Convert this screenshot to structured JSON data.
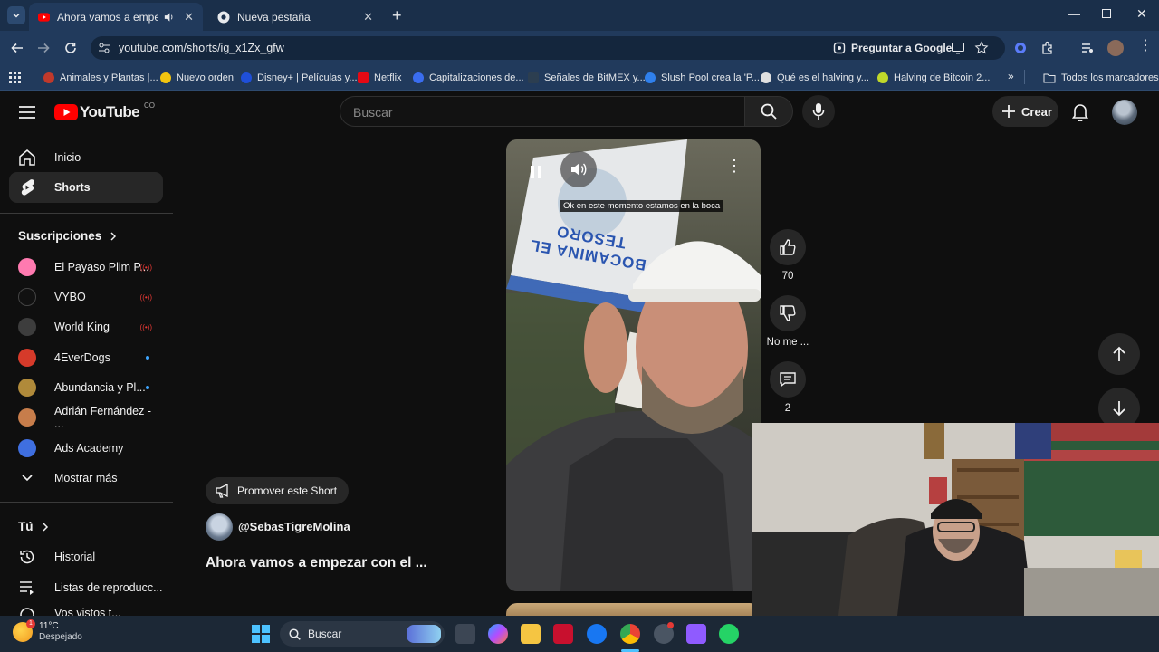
{
  "browser": {
    "tabs": [
      {
        "title": "Ahora vamos a empezar con el",
        "active": true
      },
      {
        "title": "Nueva pestaña",
        "active": false
      }
    ],
    "url": "youtube.com/shorts/ig_x1Zx_gfw",
    "ask_google": "Preguntar a Google",
    "bookmarks": [
      {
        "label": "Animales y Plantas |...",
        "color": "#c0392b"
      },
      {
        "label": "Nuevo orden",
        "color": "#f1c40f"
      },
      {
        "label": "Disney+ | Películas y...",
        "color": "#1f4fd8"
      },
      {
        "label": "Netflix",
        "color": "#e50914"
      },
      {
        "label": "Capitalizaciones de...",
        "color": "#3a6df0"
      },
      {
        "label": "Señales de BitMEX y...",
        "color": "#2c3e50"
      },
      {
        "label": "Slush Pool crea la 'P...",
        "color": "#2f80ed"
      },
      {
        "label": "Qué es el halving y...",
        "color": "#e0e0e0"
      },
      {
        "label": "Halving de Bitcoin 2...",
        "color": "#c0d82a"
      }
    ],
    "all_bookmarks": "Todos los marcadores"
  },
  "youtube": {
    "logo_text": "YouTube",
    "country": "CO",
    "search_placeholder": "Buscar",
    "create_label": "Crear",
    "sidebar": {
      "home": "Inicio",
      "shorts": "Shorts",
      "subscriptions_heading": "Suscripciones",
      "subscriptions": [
        {
          "name": "El Payaso Plim P...",
          "color": "#ff7ab0",
          "badge": "live"
        },
        {
          "name": "VYBO",
          "color": "#111111",
          "badge": "live"
        },
        {
          "name": "World King",
          "color": "#3d3d3d",
          "badge": "live"
        },
        {
          "name": "4EverDogs",
          "color": "#d63a2a",
          "badge": "new"
        },
        {
          "name": "Abundancia y Pl...",
          "color": "#b08a3a",
          "badge": "new"
        },
        {
          "name": "Adrián Fernández - ...",
          "color": "#c77d4b",
          "badge": ""
        },
        {
          "name": "Ads Academy",
          "color": "#3f6fe0",
          "badge": ""
        }
      ],
      "show_more": "Mostrar más",
      "you_heading": "Tú",
      "history": "Historial",
      "playlists": "Listas de reproducc...",
      "partial_item": "Vos vistos t..."
    },
    "short": {
      "caption": "Ok en este momento estamos en la boca",
      "sign_text": "BOCAMINA EL TESORO",
      "likes": "70",
      "dislike_label": "No me ...",
      "comments": "2",
      "promote_label": "Promover este Short",
      "channel": "@SebasTigreMolina",
      "title": "Ahora vamos a empezar con el ..."
    }
  },
  "taskbar": {
    "temperature": "11°C",
    "weather": "Despejado",
    "search_label": "Buscar"
  }
}
